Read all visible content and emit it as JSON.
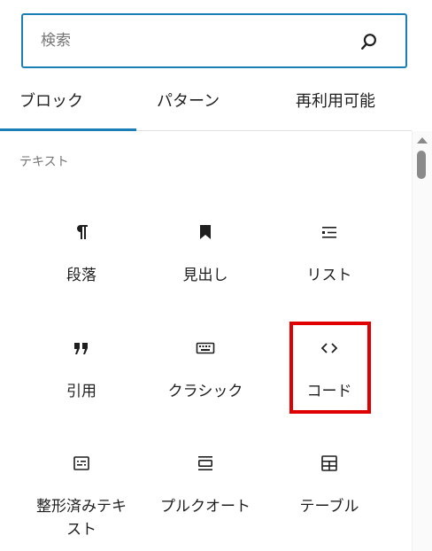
{
  "search": {
    "placeholder": "検索",
    "value": ""
  },
  "tabs": [
    {
      "label": "ブロック",
      "active": true
    },
    {
      "label": "パターン",
      "active": false
    },
    {
      "label": "再利用可能",
      "active": false
    }
  ],
  "category": {
    "title": "テキスト"
  },
  "blocks": [
    {
      "label": "段落",
      "icon": "paragraph-icon"
    },
    {
      "label": "見出し",
      "icon": "bookmark-icon"
    },
    {
      "label": "リスト",
      "icon": "list-icon"
    },
    {
      "label": "引用",
      "icon": "quote-icon"
    },
    {
      "label": "クラシック",
      "icon": "keyboard-icon"
    },
    {
      "label": "コード",
      "icon": "code-icon",
      "highlighted": true
    },
    {
      "label": "整形済みテキスト",
      "label_line1": "整形済みテキ",
      "label_line2": "スト",
      "icon": "preformatted-icon"
    },
    {
      "label": "プルクオート",
      "icon": "pullquote-icon"
    },
    {
      "label": "テーブル",
      "icon": "table-icon"
    }
  ],
  "colors": {
    "accent": "#1a7fb5",
    "highlight": "#e00000",
    "text": "#1e1e1e",
    "muted": "#757575"
  }
}
